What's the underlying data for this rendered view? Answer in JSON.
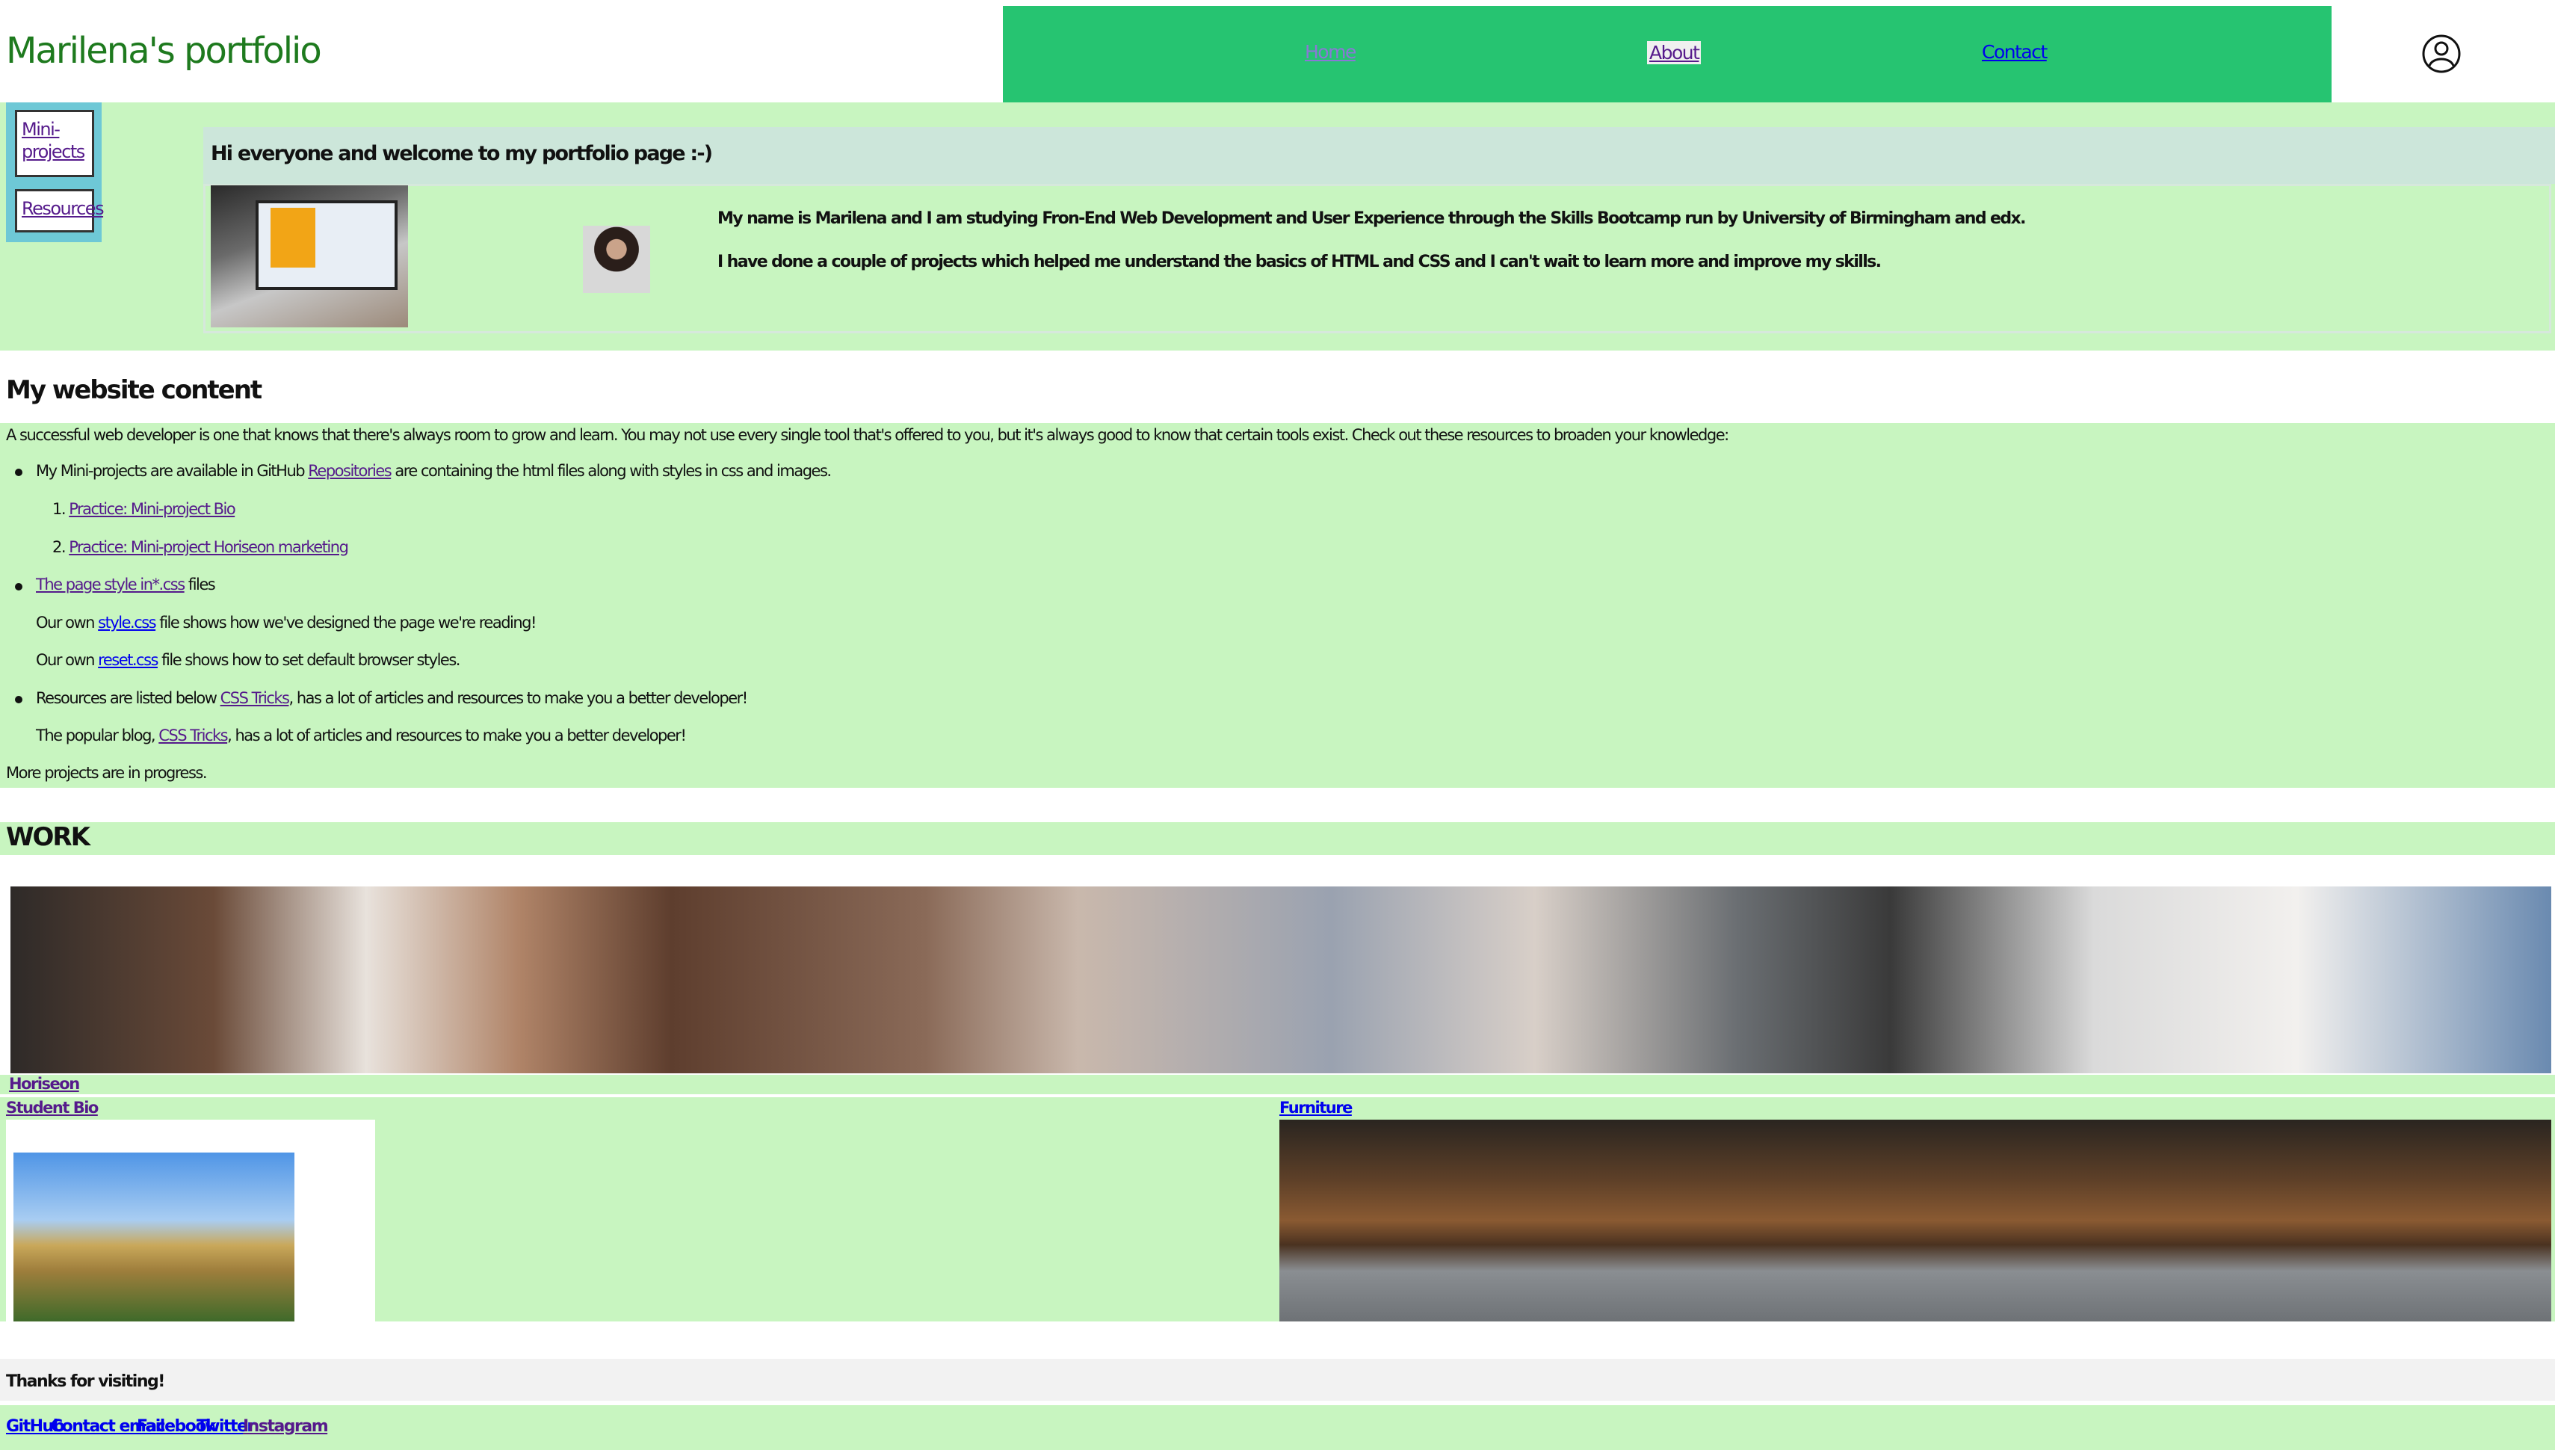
{
  "header": {
    "title": "Marilena's portfolio",
    "nav": {
      "home": "Home",
      "about": "About",
      "contact": "Contact"
    }
  },
  "aside": {
    "mini_projects": "Mini-projects",
    "resources": "Resources"
  },
  "intro": {
    "welcome": "Hi everyone and welcome to my portfolio page :-)",
    "p1": "My name is Marilena and I am studying Fron-End Web Development and User Experience through the Skills Bootcamp run by University of Birmingham and edx.",
    "p2": "I have done a couple of projects which helped me understand the basics of HTML and CSS and I can't wait to learn more and improve my skills."
  },
  "content": {
    "heading": "My website content",
    "lead": "A successful web developer is one that knows that there's always room to grow and learn. You may not use every single tool that's offered to you, but it's always good to know that certain tools exist. Check out these resources to broaden your knowledge:",
    "item1_pre": "My Mini-projects are available in GitHub ",
    "item1_link": "Repositories",
    "item1_post": " are containing the html files along with styles in css and images.",
    "sub1_num": "1.",
    "sub1": "Practice: Mini-project Bio",
    "sub2_num": "2.",
    "sub2": "Practice: Mini-project Horiseon marketing",
    "item2_link": "The page style in*.css",
    "item2_post": " files",
    "style_pre": "Our own ",
    "style_link": "style.css",
    "style_post": " file shows how we've designed the page we're reading!",
    "reset_pre": "Our own ",
    "reset_link": "reset.css",
    "reset_post": " file shows how to set default browser styles.",
    "item3_pre": "Resources are listed below ",
    "item3_link": "CSS Tricks",
    "item3_post": ", has a lot of articles and resources to make you a better developer!",
    "blog_pre": "The popular blog, ",
    "blog_link": "CSS Tricks",
    "blog_post": ", has a lot of articles and resources to make you a better developer!",
    "more": "More projects are in progress."
  },
  "work": {
    "heading": "WORK",
    "horiseon": "Horiseon",
    "student_bio": "Student Bio",
    "furniture": "Furniture"
  },
  "footer": {
    "thanks": "Thanks for visiting!",
    "links": [
      "GitHub",
      "Contact email",
      "Facebook",
      "Twitter",
      "Instagram"
    ]
  }
}
